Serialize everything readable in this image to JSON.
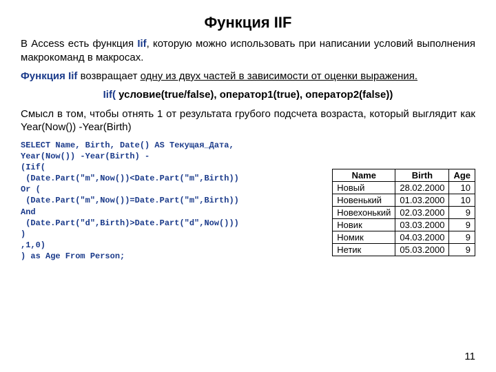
{
  "title": "Функция IIF",
  "p1_a": "В Access есть функция ",
  "p1_fn": "Iif",
  "p1_b": ", которую можно использовать при написании условий выполнения макрокоманд в макросах.",
  "p2_a": "Функция Iif",
  "p2_b": " возвращает ",
  "p2_c": "одну из двух частей в зависимости от оценки выражения.",
  "syntax_fn": "Iif(",
  "syntax_body": " условие(true/false), оператор1(true), оператор2(false))",
  "p3": "Смысл в том, чтобы отнять 1 от результата грубого подсчета возраста, который выглядит как Year(Now()) -Year(Birth)",
  "code": "SELECT Name, Birth, Date() AS Текущая_Дата,\nYear(Now()) -Year(Birth) -\n(Iif(\n (Date.Part(\"m\",Now())<Date.Part(\"m\",Birth))\nOr (\n (Date.Part(\"m\",Now())=Date.Part(\"m\",Birth))\nAnd\n (Date.Part(\"d\",Birth)>Date.Part(\"d\",Now()))\n)\n,1,0)\n) as Age From Person;",
  "table": {
    "headers": [
      "Name",
      "Birth",
      "Age"
    ],
    "rows": [
      [
        "Новый",
        "28.02.2000",
        "10"
      ],
      [
        "Новенький",
        "01.03.2000",
        "10"
      ],
      [
        "Новехонький",
        "02.03.2000",
        "9"
      ],
      [
        "Новик",
        "03.03.2000",
        "9"
      ],
      [
        "Номик",
        "04.03.2000",
        "9"
      ],
      [
        "Нетик",
        "05.03.2000",
        "9"
      ]
    ]
  },
  "pagenum": "11"
}
